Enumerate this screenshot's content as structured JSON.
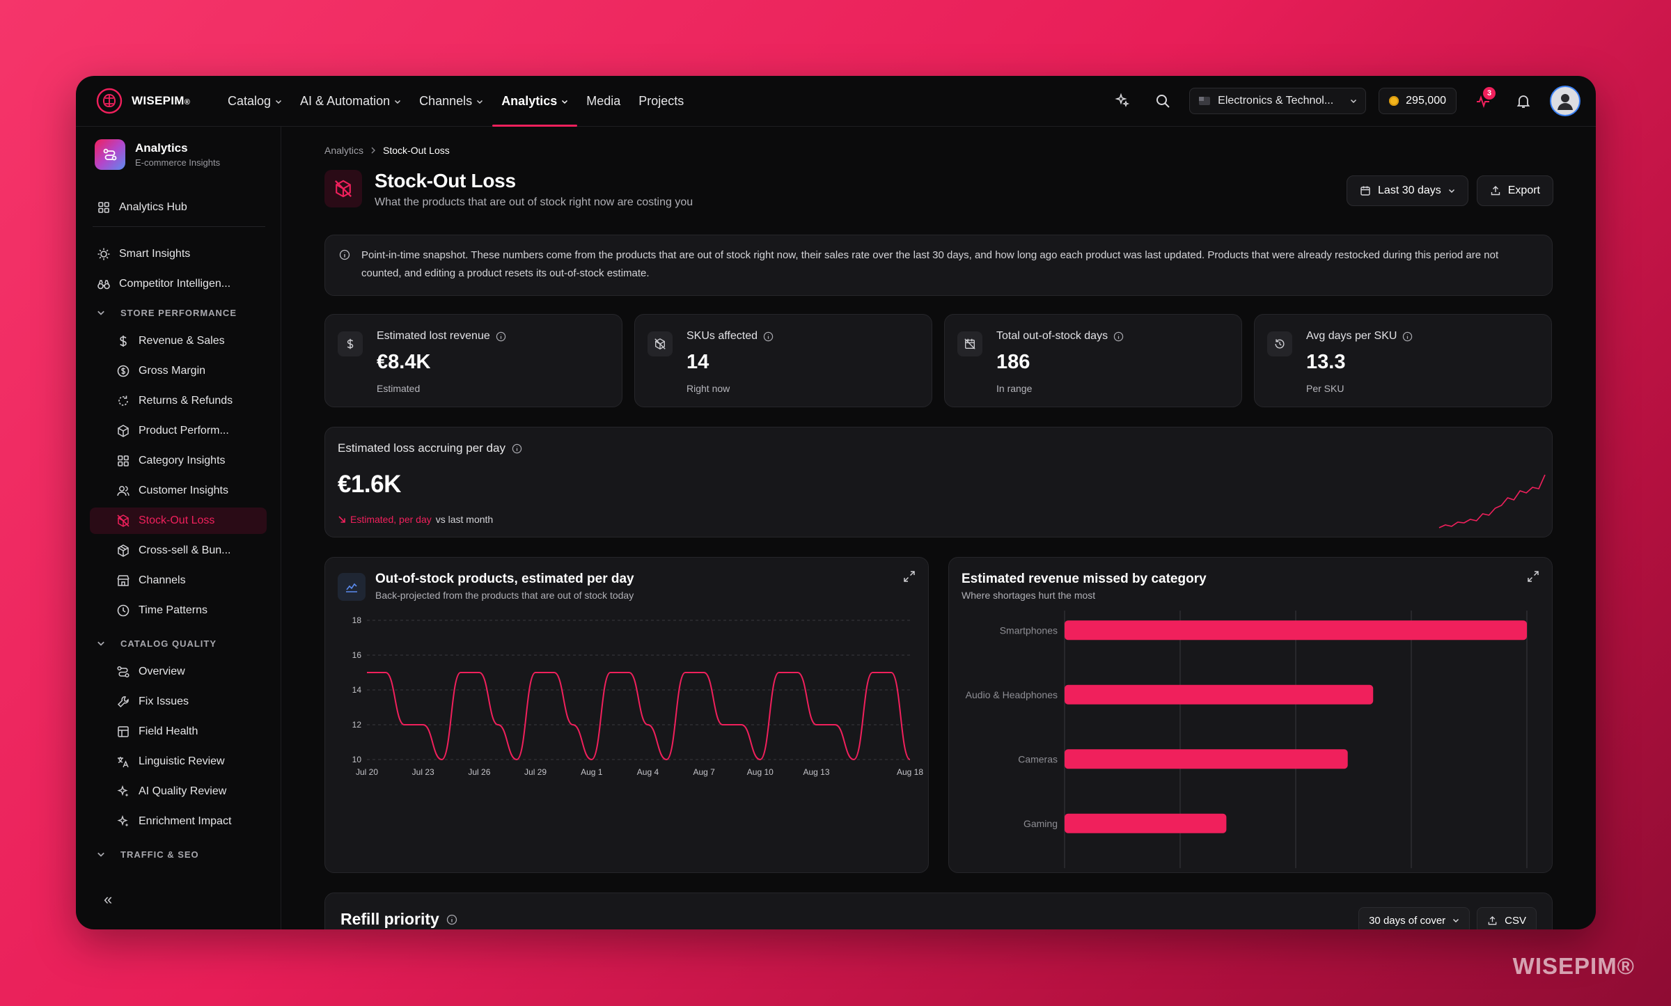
{
  "brand": {
    "name": "WISEPIM",
    "mark": "®",
    "watermark": "WISEPIM®"
  },
  "nav": [
    {
      "label": "Catalog",
      "has_menu": true
    },
    {
      "label": "AI & Automation",
      "has_menu": true
    },
    {
      "label": "Channels",
      "has_menu": true
    },
    {
      "label": "Analytics",
      "has_menu": true,
      "active": true
    },
    {
      "label": "Media",
      "has_menu": false
    },
    {
      "label": "Projects",
      "has_menu": false
    }
  ],
  "topbar": {
    "store": "Electronics & Technol...",
    "credits": "295,000",
    "notification_count": "3"
  },
  "sidebar": {
    "app_title": "Analytics",
    "app_subtitle": "E-commerce Insights",
    "hub": "Analytics Hub",
    "smart": "Smart Insights",
    "competitor": "Competitor Intelligen...",
    "sections": {
      "store": "STORE PERFORMANCE",
      "catalog": "CATALOG QUALITY",
      "traffic": "TRAFFIC & SEO"
    },
    "store_items": [
      {
        "label": "Revenue & Sales",
        "icon": "dollar-icon"
      },
      {
        "label": "Gross Margin",
        "icon": "coin-icon"
      },
      {
        "label": "Returns & Refunds",
        "icon": "return-icon"
      },
      {
        "label": "Product Perform...",
        "icon": "box-icon"
      },
      {
        "label": "Category Insights",
        "icon": "grid-icon"
      },
      {
        "label": "Customer Insights",
        "icon": "users-icon"
      },
      {
        "label": "Stock-Out Loss",
        "icon": "stockout-icon",
        "active": true
      },
      {
        "label": "Cross-sell & Bun...",
        "icon": "package-icon"
      },
      {
        "label": "Channels",
        "icon": "store-icon"
      },
      {
        "label": "Time Patterns",
        "icon": "clock-icon"
      }
    ],
    "catalog_items": [
      {
        "label": "Overview",
        "icon": "flow-icon"
      },
      {
        "label": "Fix Issues",
        "icon": "wrench-icon"
      },
      {
        "label": "Field Health",
        "icon": "table-icon"
      },
      {
        "label": "Linguistic Review",
        "icon": "translate-icon"
      },
      {
        "label": "AI Quality Review",
        "icon": "sparkles-icon"
      },
      {
        "label": "Enrichment Impact",
        "icon": "sparkles-icon"
      }
    ],
    "collapse": "«"
  },
  "breadcrumb": [
    "Analytics",
    "Stock-Out Loss"
  ],
  "page": {
    "title": "Stock-Out Loss",
    "subtitle": "What the products that are out of stock right now are costing you",
    "range_label": "Last 30 days",
    "export_label": "Export"
  },
  "info": "Point-in-time snapshot. These numbers come from the products that are out of stock right now, their sales rate over the last 30 days, and how long ago each product was last updated. Products that were already restocked during this period are not counted, and editing a product resets its out-of-stock estimate.",
  "stats": [
    {
      "label": "Estimated lost revenue",
      "value": "€8.4K",
      "note": "Estimated",
      "icon": "dollar-icon"
    },
    {
      "label": "SKUs affected",
      "value": "14",
      "note": "Right now",
      "icon": "stockout-icon"
    },
    {
      "label": "Total out-of-stock days",
      "value": "186",
      "note": "In range",
      "icon": "calendar-off-icon"
    },
    {
      "label": "Avg days per SKU",
      "value": "13.3",
      "note": "Per SKU",
      "icon": "history-icon"
    }
  ],
  "daily_loss": {
    "label": "Estimated loss accruing per day",
    "value": "€1.6K",
    "note_highlight": "Estimated, per day",
    "note_rest": "vs last month",
    "sparkline": [
      2,
      6,
      4,
      10,
      9,
      14,
      12,
      22,
      20,
      30,
      34,
      45,
      42,
      55,
      52,
      60,
      58,
      78
    ]
  },
  "line_chart": {
    "title": "Out-of-stock products, estimated per day",
    "subtitle": "Back-projected from the products that are out of stock today"
  },
  "bar_chart": {
    "title": "Estimated revenue missed by category",
    "subtitle": "Where shortages hurt the most"
  },
  "chart_data": [
    {
      "type": "line",
      "title": "Out-of-stock products, estimated per day",
      "x_ticks": [
        "Jul 20",
        "Jul 23",
        "Jul 26",
        "Jul 29",
        "Aug 1",
        "Aug 4",
        "Aug 7",
        "Aug 10",
        "Aug 13",
        "Aug 18"
      ],
      "x": [
        "Jul 20",
        "Jul 21",
        "Jul 22",
        "Jul 23",
        "Jul 24",
        "Jul 25",
        "Jul 26",
        "Jul 27",
        "Jul 28",
        "Jul 29",
        "Jul 30",
        "Jul 31",
        "Aug 1",
        "Aug 2",
        "Aug 3",
        "Aug 4",
        "Aug 5",
        "Aug 6",
        "Aug 7",
        "Aug 8",
        "Aug 9",
        "Aug 10",
        "Aug 11",
        "Aug 12",
        "Aug 13",
        "Aug 14",
        "Aug 15",
        "Aug 16",
        "Aug 17",
        "Aug 18"
      ],
      "values": [
        15,
        15,
        12,
        12,
        10,
        15,
        15,
        12,
        10,
        15,
        15,
        12,
        10,
        15,
        15,
        12,
        10,
        15,
        15,
        12,
        12,
        10,
        15,
        15,
        12,
        12,
        10,
        15,
        15,
        10
      ],
      "y_ticks": [
        10,
        12,
        14,
        16,
        18
      ],
      "ylim": [
        10,
        18
      ],
      "grid": true,
      "color": "#f0205c"
    },
    {
      "type": "bar",
      "orientation": "horizontal",
      "title": "Estimated revenue missed by category",
      "categories": [
        "Smartphones",
        "Audio & Headphones",
        "Cameras",
        "Gaming"
      ],
      "values": [
        4000,
        2670,
        2450,
        1400
      ],
      "xlim": [
        0,
        4000
      ],
      "grid": true,
      "color": "#f0205c"
    }
  ],
  "refill": {
    "title": "Refill priority",
    "cover_label": "30 days of cover",
    "csv_label": "CSV"
  }
}
